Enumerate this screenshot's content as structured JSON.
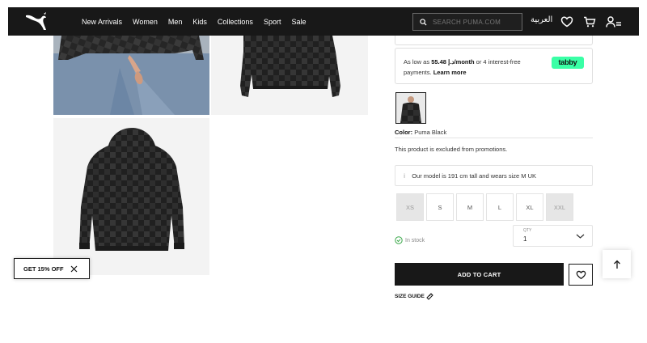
{
  "header": {
    "brand": "PUMA",
    "nav": [
      "New Arrivals",
      "Women",
      "Men",
      "Kids",
      "Collections",
      "Sport",
      "Sale"
    ],
    "search_placeholder": "SEARCH PUMA.COM",
    "language": "العربية",
    "icons": [
      "search-icon",
      "heart-icon",
      "cart-icon",
      "account-icon"
    ]
  },
  "gallery": {
    "images": [
      "model-wearing-hoodie",
      "hoodie-back",
      "hoodie-back-flat"
    ]
  },
  "product": {
    "installments_text_prefix": "As low as",
    "installments_amount": "د.إ 55.48/month",
    "installments_text_suffix": "or 4 interest-free payments.",
    "learn_more": "Learn more",
    "tabby_logo": "tabby",
    "color_label": "Color:",
    "color_value": "Puma Black",
    "promo_note": "This product is excluded from promotions.",
    "model_note": "Our model is 191 cm tall and wears size M UK",
    "sizes": [
      {
        "label": "XS",
        "available": false
      },
      {
        "label": "S",
        "available": true
      },
      {
        "label": "M",
        "available": true
      },
      {
        "label": "L",
        "available": true
      },
      {
        "label": "XL",
        "available": true
      },
      {
        "label": "XXL",
        "available": false
      }
    ],
    "stock_status": "In stock",
    "quantity_label": "QTY",
    "quantity": "1",
    "add_to_cart": "ADD TO CART",
    "size_guide": "SIZE GUIDE"
  },
  "offer_banner": {
    "label": "GET 15% OFF"
  },
  "colors": {
    "header_bg": "#181818",
    "tabby_green": "#3affa6",
    "stock_green": "#3aa84a",
    "button_bg": "#181818"
  }
}
